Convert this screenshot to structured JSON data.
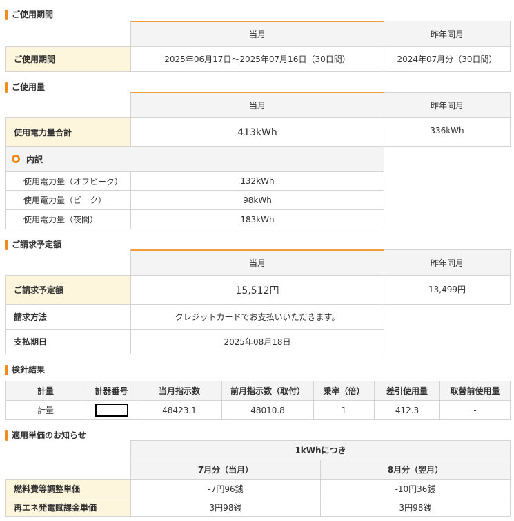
{
  "period": {
    "section_title": "ご使用期間",
    "col_current": "当月",
    "col_prev": "昨年同月",
    "row_label": "ご使用期間",
    "current_value": "2025年06月17日～2025年07月16日（30日間）",
    "prev_value": "2024年07月分（30日間）"
  },
  "usage": {
    "section_title": "ご使用量",
    "col_current": "当月",
    "col_prev": "昨年同月",
    "total_label": "使用電力量合計",
    "total_current": "413kWh",
    "total_prev": "336kWh",
    "breakdown_title": "内訳",
    "breakdown": [
      {
        "label": "使用電力量（オフピーク）",
        "value": "132kWh"
      },
      {
        "label": "使用電力量（ピーク）",
        "value": "98kWh"
      },
      {
        "label": "使用電力量（夜間）",
        "value": "183kWh"
      }
    ]
  },
  "billing": {
    "section_title": "ご請求予定額",
    "col_current": "当月",
    "col_prev": "昨年同月",
    "amount_label": "ご請求予定額",
    "amount_current": "15,512円",
    "amount_prev": "13,499円",
    "method_label": "請求方法",
    "method_value": "クレジットカードでお支払いいただきます。",
    "due_label": "支払期日",
    "due_value": "2025年08月18日"
  },
  "meter": {
    "section_title": "検針結果",
    "headers": [
      "計量",
      "計器番号",
      "当月指示数",
      "前月指示数（取付）",
      "乗率（倍）",
      "差引使用量",
      "取替前使用量"
    ],
    "row": [
      "計量",
      "",
      "48423.1",
      "48010.8",
      "1",
      "412.3",
      "-"
    ]
  },
  "unit_price": {
    "section_title": "適用単価のお知らせ",
    "header": "1kWhにつき",
    "col_current": "7月分（当月）",
    "col_next": "8月分（翌月）",
    "rows": [
      {
        "label": "燃料費等調整単価",
        "current": "-7円96銭",
        "next": "-10円36銭"
      },
      {
        "label": "再エネ発電賦課金単価",
        "current": "3円98銭",
        "next": "3円98銭"
      }
    ]
  },
  "colors": {
    "accent": "#f08c1e",
    "label_bg": "#fdf5dc",
    "header_bg": "#f4f4f4",
    "border": "#d4d4d4"
  }
}
